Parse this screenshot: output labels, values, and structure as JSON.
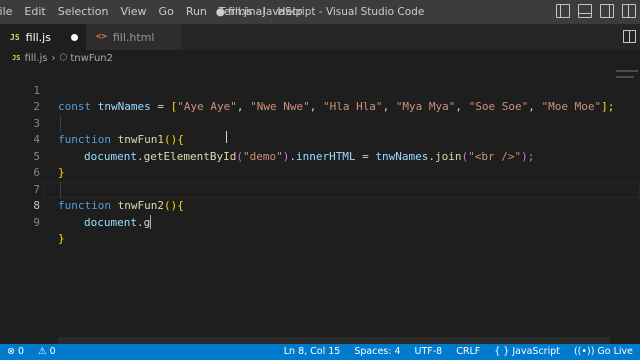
{
  "menu": [
    "File",
    "Edit",
    "Selection",
    "View",
    "Go",
    "Run",
    "Terminal",
    "Help"
  ],
  "window_title": "● fill.js - JavaScript - Visual Studio Code",
  "tabs": [
    {
      "label": "fill.js",
      "icon": "JS",
      "active": true,
      "dirty": true
    },
    {
      "label": "fill.html",
      "icon": "<>",
      "active": false
    }
  ],
  "breadcrumb": {
    "file": "fill.js",
    "file_icon": "JS",
    "symbol": "tnwFun2",
    "separator": "›"
  },
  "editor": {
    "line_numbers": [
      "1",
      "2",
      "3",
      "4",
      "5",
      "6",
      "7",
      "8",
      "9"
    ],
    "tokens": {
      "l1": [
        "const ",
        "tnwNames",
        " = ",
        "[",
        "\"Aye Aye\"",
        ", ",
        "\"Nwe Nwe\"",
        ", ",
        "\"Hla Hla\"",
        ", ",
        "\"Mya Mya\"",
        ", ",
        "\"Soe Soe\"",
        ", ",
        "\"Moe Moe\"",
        "];"
      ],
      "l3": [
        "function ",
        "tnwFun1",
        "(",
        ")",
        "{"
      ],
      "l4": [
        "document",
        ".",
        "getElementById",
        "(",
        "\"demo\"",
        ")",
        ".",
        "innerHTML",
        " = ",
        "tnwNames",
        ".",
        "join",
        "(",
        "\"<br />\"",
        ");"
      ],
      "l5": [
        "}"
      ],
      "l7": [
        "function ",
        "tnwFun2",
        "(",
        ")",
        "{"
      ],
      "l8": [
        "document",
        ".",
        "g"
      ],
      "l9": [
        "}"
      ]
    }
  },
  "status": {
    "errors": "⊗ 0",
    "warnings": "⚠ 0",
    "position": "Ln 8, Col 15",
    "spaces": "Spaces: 4",
    "encoding": "UTF-8",
    "eol": "CRLF",
    "language": "JavaScript",
    "language_icon": "{ }",
    "go_live": "Go Live",
    "go_live_icon": "((•))"
  },
  "colors": {
    "statusbar": "#007acc",
    "titlebar": "#3c3c3c",
    "editor_bg": "#1e1e1e",
    "keyword": "#569cd6",
    "string": "#ce9178",
    "function": "#dcdcaa",
    "variable": "#9cdcfe"
  }
}
